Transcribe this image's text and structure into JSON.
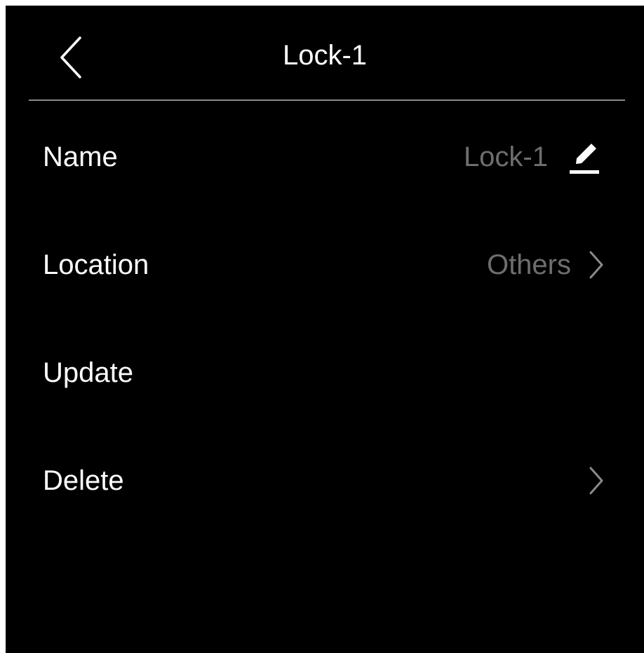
{
  "header": {
    "title": "Lock-1",
    "back_icon": "chevron-left-icon"
  },
  "settings": {
    "items": [
      {
        "label": "Name",
        "value": "Lock-1",
        "icon": "edit-icon"
      },
      {
        "label": "Location",
        "value": "Others",
        "icon": "chevron-right-icon"
      },
      {
        "label": "Update"
      },
      {
        "label": "Delete",
        "icon": "chevron-right-icon"
      }
    ]
  },
  "colors": {
    "background": "#000000",
    "primary_text": "#ffffff",
    "secondary_text": "#6e6e6e",
    "divider": "#8a8a8a"
  }
}
